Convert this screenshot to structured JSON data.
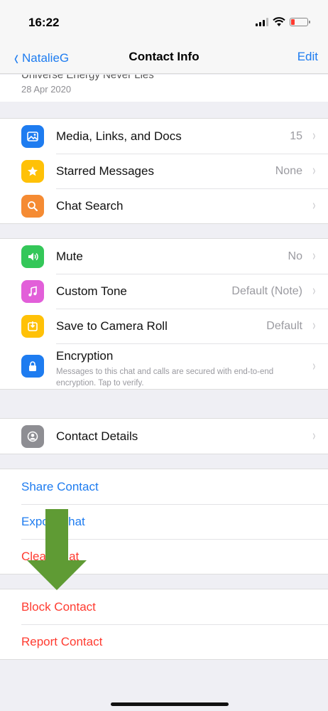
{
  "status": {
    "time": "16:22"
  },
  "nav": {
    "back_label": "NatalieG",
    "title": "Contact Info",
    "edit_label": "Edit"
  },
  "about": {
    "text": "Universe Energy Never Lies",
    "date": "28 Apr 2020"
  },
  "group1": [
    {
      "label": "Media, Links, and Docs",
      "value": "15",
      "icon": "image-icon",
      "color": "#1e7cf0"
    },
    {
      "label": "Starred Messages",
      "value": "None",
      "icon": "star-icon",
      "color": "#ffc107"
    },
    {
      "label": "Chat Search",
      "value": "",
      "icon": "search-icon",
      "color": "#f58b33"
    }
  ],
  "group2": [
    {
      "label": "Mute",
      "value": "No",
      "icon": "speaker-icon",
      "color": "#34c759"
    },
    {
      "label": "Custom Tone",
      "value": "Default (Note)",
      "icon": "music-note-icon",
      "color": "#e25fd9"
    },
    {
      "label": "Save to Camera Roll",
      "value": "Default",
      "icon": "save-icon",
      "color": "#ffc107"
    }
  ],
  "encryption": {
    "title": "Encryption",
    "subtitle": "Messages to this chat and calls are secured with end-to-end encryption. Tap to verify.",
    "color": "#1e7cf0",
    "icon": "lock-icon"
  },
  "contact_details": {
    "label": "Contact Details",
    "icon": "person-icon",
    "color": "#8e8e93"
  },
  "actions": [
    {
      "label": "Share Contact",
      "color": "#1e7cf0"
    },
    {
      "label": "Export Chat",
      "color": "#1e7cf0"
    },
    {
      "label": "Clear Chat",
      "color": "#ff3b30"
    }
  ],
  "danger": [
    {
      "label": "Block Contact",
      "color": "#ff3b30"
    },
    {
      "label": "Report Contact",
      "color": "#ff3b30"
    }
  ],
  "arrow_color": "#5f9b34"
}
